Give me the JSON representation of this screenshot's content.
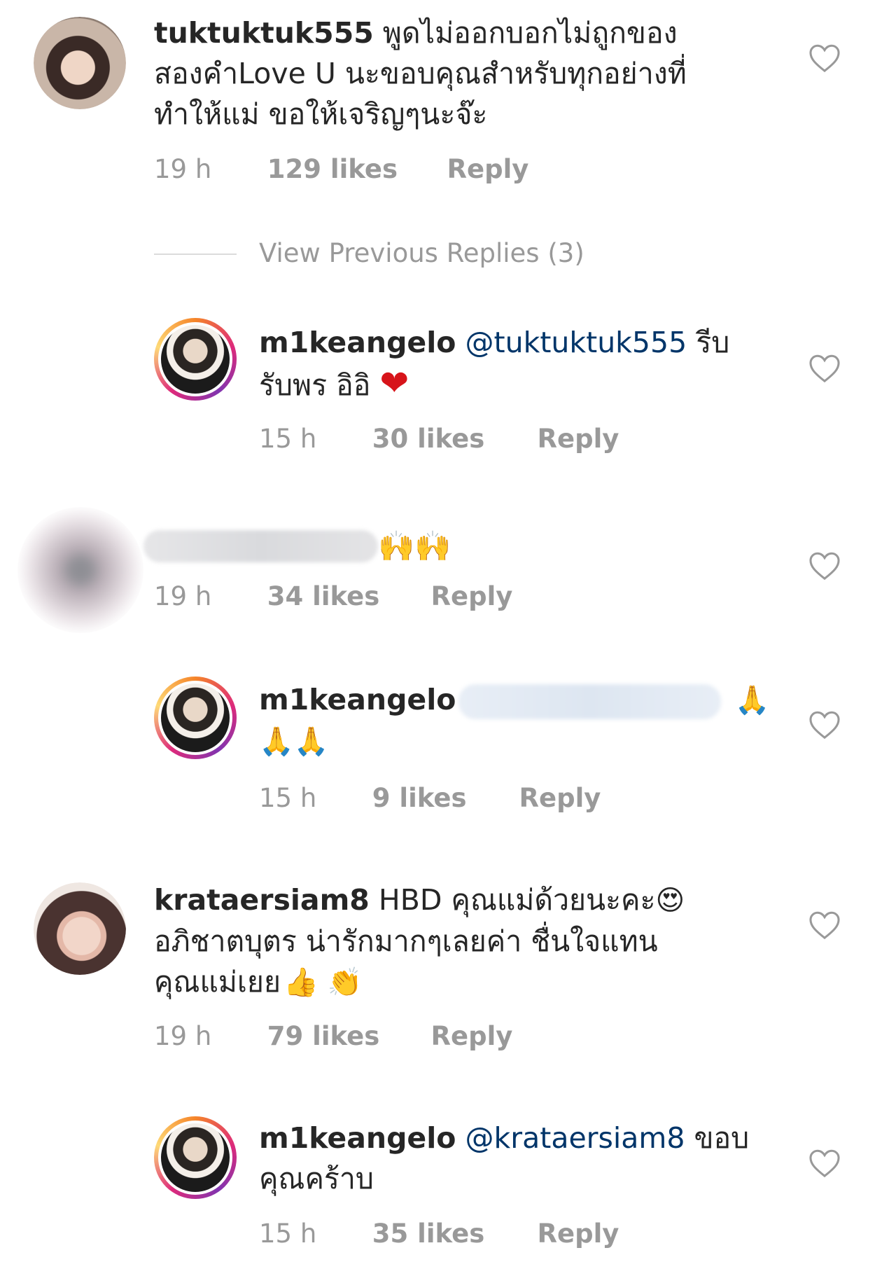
{
  "comments": [
    {
      "username": "tuktuktuk555",
      "text": "พูดไม่ออกบอกไม่ถูกของ",
      "text_line2": "สองคำLove U นะขอบคุณสำหรับทุกอย่างที่",
      "text_line3": "ทำให้แม่ ขอให้เจริญๆนะจ๊ะ",
      "time": "19 h",
      "likes": "129 likes",
      "reply": "Reply"
    },
    {
      "view_previous": "View Previous Replies (3)"
    },
    {
      "username": "m1keangelo",
      "mention": "@tuktuktuk555",
      "text": " รีบ",
      "text_line2": "รับพร อิอิ ",
      "emoji": "❤",
      "time": "15 h",
      "likes": "30 likes",
      "reply": "Reply"
    },
    {
      "emoji": "🙌🙌",
      "time": "19 h",
      "likes": "34 likes",
      "reply": "Reply"
    },
    {
      "username": "m1keangelo",
      "emoji": "🙏",
      "emoji_line2": "🙏🙏",
      "time": "15 h",
      "likes": "9 likes",
      "reply": "Reply"
    },
    {
      "username": "krataersiam8",
      "text": " HBD คุณแม่ด้วยนะคะ",
      "emoji": "😍",
      "text_line2": "อภิชาตบุตร น่ารักมากๆเลยค่า ชื่นใจแทน",
      "text_line3": "คุณแม่เยย",
      "emoji_line3": "👍 👏",
      "time": "19 h",
      "likes": "79 likes",
      "reply": "Reply"
    },
    {
      "username": "m1keangelo",
      "mention": "@krataersiam8",
      "text": " ขอบ",
      "text_line2": "คุณคร้าบ",
      "time": "15 h",
      "likes": "35 likes",
      "reply": "Reply"
    }
  ],
  "colors": {
    "text": "#262626",
    "muted": "#999999",
    "mention": "#003569",
    "heart_red": "#d7141a"
  },
  "icons": {
    "like": "heart-outline-icon"
  }
}
